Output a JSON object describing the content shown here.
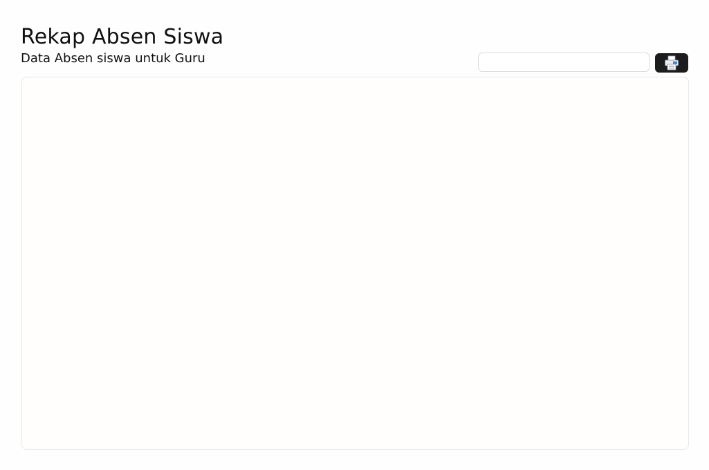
{
  "header": {
    "title": "Rekap Absen Siswa",
    "subtitle": "Data Absen siswa untuk Guru"
  },
  "toolbar": {
    "search": {
      "value": "",
      "placeholder": ""
    },
    "print_button": {
      "icon": "printer-icon"
    }
  },
  "colors": {
    "print_button_bg": "#1c1c1c",
    "printer_body": "#e9eef5",
    "printer_screen": "#3b7fd9",
    "panel_border": "#e8e8e8"
  }
}
